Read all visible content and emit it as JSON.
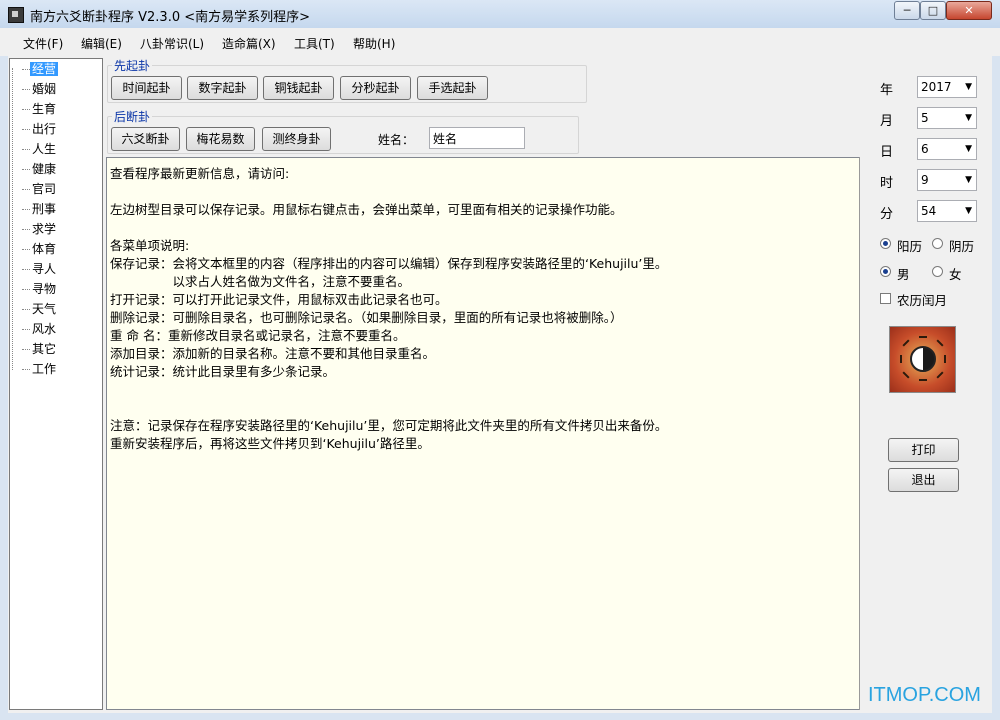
{
  "window": {
    "title": "南方六爻断卦程序 V2.3.0   <南方易学系列程序>",
    "controls": [
      "─",
      "□",
      "✕"
    ]
  },
  "menu": [
    "文件(F)",
    "编辑(E)",
    "八卦常识(L)",
    "造命篇(X)",
    "工具(T)",
    "帮助(H)"
  ],
  "tree": [
    "经营",
    "婚姻",
    "生育",
    "出行",
    "人生",
    "健康",
    "官司",
    "刑事",
    "求学",
    "体育",
    "寻人",
    "寻物",
    "天气",
    "风水",
    "其它",
    "工作"
  ],
  "first_group": {
    "title": "先起卦",
    "buttons": [
      "时间起卦",
      "数字起卦",
      "铜钱起卦",
      "分秒起卦",
      "手选起卦"
    ]
  },
  "second_group": {
    "title": "后断卦",
    "buttons": [
      "六爻断卦",
      "梅花易数",
      "测终身卦"
    ]
  },
  "name": {
    "label": "姓名：",
    "value": "姓名"
  },
  "text_lines": [
    "查看程序最新更新信息，请访问:",
    "",
    "左边树型目录可以保存记录。用鼠标右键点击，会弹出菜单，可里面有相关的记录操作功能。",
    "",
    "各菜单项说明:",
    "保存记录：会将文本框里的内容（程序排出的内容可以编辑）保存到程序安装路径里的‘Kehujilu’里。",
    "　　　　　以求占人姓名做为文件名，注意不要重名。",
    "打开记录：可以打开此记录文件，用鼠标双击此记录名也可。",
    "删除记录：可删除目录名，也可删除记录名。（如果删除目录，里面的所有记录也将被删除。）",
    "重 命 名：重新修改目录名或记录名，注意不要重名。",
    "添加目录：添加新的目录名称。注意不要和其他目录重名。",
    "统计记录：统计此目录里有多少条记录。",
    "",
    "",
    "注意：记录保存在程序安装路径里的‘Kehujilu’里，您可定期将此文件夹里的所有文件拷贝出来备份。",
    "重新安装程序后，再将这些文件拷贝到‘Kehujilu’路径里。"
  ],
  "datetime": [
    {
      "label": "年",
      "value": "2017"
    },
    {
      "label": "月",
      "value": "5"
    },
    {
      "label": "日",
      "value": "6"
    },
    {
      "label": "时",
      "value": "9"
    },
    {
      "label": "分",
      "value": "54"
    }
  ],
  "options": {
    "calendar": [
      "阳历",
      "阴历"
    ],
    "gender": [
      "男",
      "女"
    ],
    "leap_month": "农历闰月"
  },
  "actions": {
    "print": "打印",
    "exit": "退出"
  },
  "watermark": "ITMOP.COM",
  "colors": {
    "selected": "#3399ff",
    "group_title": "#0b36a8",
    "text_bg": "#fffff0"
  }
}
